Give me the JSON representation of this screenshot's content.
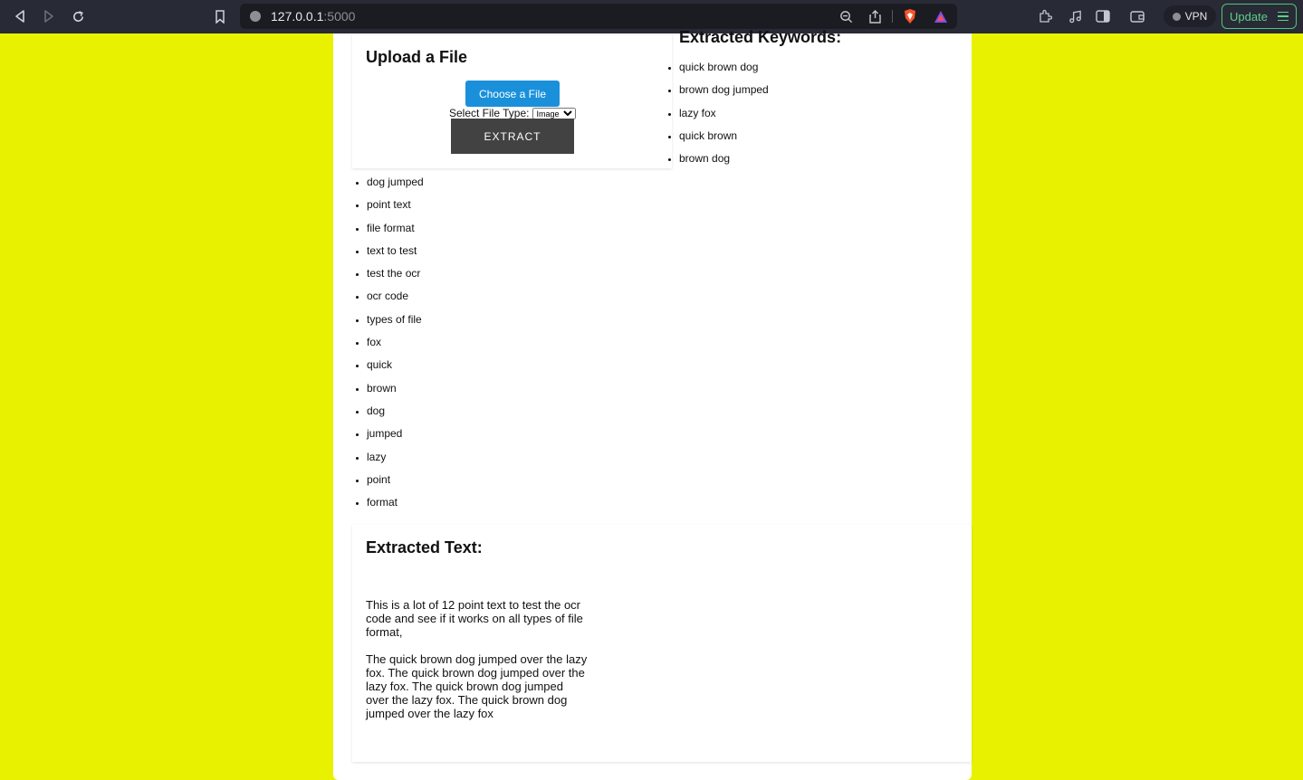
{
  "browser": {
    "url_host": "127.0.0.1",
    "url_port": ":5000",
    "vpn_label": "VPN",
    "update_label": "Update"
  },
  "upload": {
    "title": "Upload a File",
    "choose_label": "Choose a File",
    "file_type_label": "Select File Type:",
    "file_type_value": "Image",
    "extract_label": "EXTRACT"
  },
  "keywords": {
    "title": "Extracted Keywords:",
    "right_items": [
      "quick brown dog",
      "brown dog jumped",
      "lazy fox",
      "quick brown",
      "brown dog"
    ],
    "left_items": [
      "dog jumped",
      "point text",
      "file format",
      "text to test",
      "test the ocr",
      "ocr code",
      "types of file",
      "fox",
      "quick",
      "brown",
      "dog",
      "jumped",
      "lazy",
      "point",
      "format"
    ]
  },
  "extracted": {
    "title": "Extracted Text:",
    "paragraphs": [
      "This is a lot of 12 point text to test the ocr code and see if it works on all types of file format,",
      "The quick brown dog jumped over the lazy fox. The quick brown dog jumped over the lazy fox. The quick brown dog jumped over the lazy fox. The quick brown dog jumped over the lazy fox"
    ]
  },
  "colors": {
    "page_bg": "#e8f200",
    "choose_button": "#1a90db",
    "extract_button": "#424242",
    "update_green": "#5bd187"
  }
}
